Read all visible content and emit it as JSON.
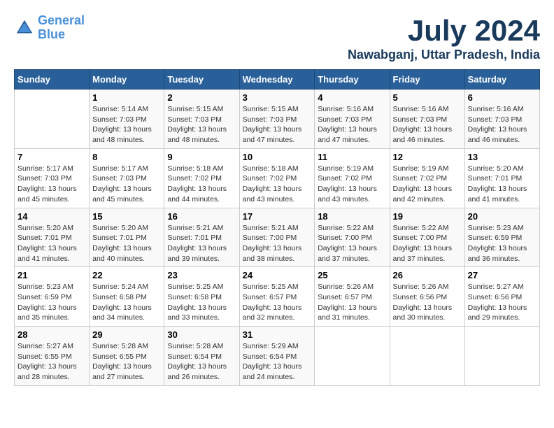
{
  "header": {
    "logo_line1": "General",
    "logo_line2": "Blue",
    "month_year": "July 2024",
    "location": "Nawabganj, Uttar Pradesh, India"
  },
  "weekdays": [
    "Sunday",
    "Monday",
    "Tuesday",
    "Wednesday",
    "Thursday",
    "Friday",
    "Saturday"
  ],
  "weeks": [
    [
      {
        "day": "",
        "info": ""
      },
      {
        "day": "1",
        "info": "Sunrise: 5:14 AM\nSunset: 7:03 PM\nDaylight: 13 hours\nand 48 minutes."
      },
      {
        "day": "2",
        "info": "Sunrise: 5:15 AM\nSunset: 7:03 PM\nDaylight: 13 hours\nand 48 minutes."
      },
      {
        "day": "3",
        "info": "Sunrise: 5:15 AM\nSunset: 7:03 PM\nDaylight: 13 hours\nand 47 minutes."
      },
      {
        "day": "4",
        "info": "Sunrise: 5:16 AM\nSunset: 7:03 PM\nDaylight: 13 hours\nand 47 minutes."
      },
      {
        "day": "5",
        "info": "Sunrise: 5:16 AM\nSunset: 7:03 PM\nDaylight: 13 hours\nand 46 minutes."
      },
      {
        "day": "6",
        "info": "Sunrise: 5:16 AM\nSunset: 7:03 PM\nDaylight: 13 hours\nand 46 minutes."
      }
    ],
    [
      {
        "day": "7",
        "info": "Sunrise: 5:17 AM\nSunset: 7:03 PM\nDaylight: 13 hours\nand 45 minutes."
      },
      {
        "day": "8",
        "info": "Sunrise: 5:17 AM\nSunset: 7:03 PM\nDaylight: 13 hours\nand 45 minutes."
      },
      {
        "day": "9",
        "info": "Sunrise: 5:18 AM\nSunset: 7:02 PM\nDaylight: 13 hours\nand 44 minutes."
      },
      {
        "day": "10",
        "info": "Sunrise: 5:18 AM\nSunset: 7:02 PM\nDaylight: 13 hours\nand 43 minutes."
      },
      {
        "day": "11",
        "info": "Sunrise: 5:19 AM\nSunset: 7:02 PM\nDaylight: 13 hours\nand 43 minutes."
      },
      {
        "day": "12",
        "info": "Sunrise: 5:19 AM\nSunset: 7:02 PM\nDaylight: 13 hours\nand 42 minutes."
      },
      {
        "day": "13",
        "info": "Sunrise: 5:20 AM\nSunset: 7:01 PM\nDaylight: 13 hours\nand 41 minutes."
      }
    ],
    [
      {
        "day": "14",
        "info": "Sunrise: 5:20 AM\nSunset: 7:01 PM\nDaylight: 13 hours\nand 41 minutes."
      },
      {
        "day": "15",
        "info": "Sunrise: 5:20 AM\nSunset: 7:01 PM\nDaylight: 13 hours\nand 40 minutes."
      },
      {
        "day": "16",
        "info": "Sunrise: 5:21 AM\nSunset: 7:01 PM\nDaylight: 13 hours\nand 39 minutes."
      },
      {
        "day": "17",
        "info": "Sunrise: 5:21 AM\nSunset: 7:00 PM\nDaylight: 13 hours\nand 38 minutes."
      },
      {
        "day": "18",
        "info": "Sunrise: 5:22 AM\nSunset: 7:00 PM\nDaylight: 13 hours\nand 37 minutes."
      },
      {
        "day": "19",
        "info": "Sunrise: 5:22 AM\nSunset: 7:00 PM\nDaylight: 13 hours\nand 37 minutes."
      },
      {
        "day": "20",
        "info": "Sunrise: 5:23 AM\nSunset: 6:59 PM\nDaylight: 13 hours\nand 36 minutes."
      }
    ],
    [
      {
        "day": "21",
        "info": "Sunrise: 5:23 AM\nSunset: 6:59 PM\nDaylight: 13 hours\nand 35 minutes."
      },
      {
        "day": "22",
        "info": "Sunrise: 5:24 AM\nSunset: 6:58 PM\nDaylight: 13 hours\nand 34 minutes."
      },
      {
        "day": "23",
        "info": "Sunrise: 5:25 AM\nSunset: 6:58 PM\nDaylight: 13 hours\nand 33 minutes."
      },
      {
        "day": "24",
        "info": "Sunrise: 5:25 AM\nSunset: 6:57 PM\nDaylight: 13 hours\nand 32 minutes."
      },
      {
        "day": "25",
        "info": "Sunrise: 5:26 AM\nSunset: 6:57 PM\nDaylight: 13 hours\nand 31 minutes."
      },
      {
        "day": "26",
        "info": "Sunrise: 5:26 AM\nSunset: 6:56 PM\nDaylight: 13 hours\nand 30 minutes."
      },
      {
        "day": "27",
        "info": "Sunrise: 5:27 AM\nSunset: 6:56 PM\nDaylight: 13 hours\nand 29 minutes."
      }
    ],
    [
      {
        "day": "28",
        "info": "Sunrise: 5:27 AM\nSunset: 6:55 PM\nDaylight: 13 hours\nand 28 minutes."
      },
      {
        "day": "29",
        "info": "Sunrise: 5:28 AM\nSunset: 6:55 PM\nDaylight: 13 hours\nand 27 minutes."
      },
      {
        "day": "30",
        "info": "Sunrise: 5:28 AM\nSunset: 6:54 PM\nDaylight: 13 hours\nand 26 minutes."
      },
      {
        "day": "31",
        "info": "Sunrise: 5:29 AM\nSunset: 6:54 PM\nDaylight: 13 hours\nand 24 minutes."
      },
      {
        "day": "",
        "info": ""
      },
      {
        "day": "",
        "info": ""
      },
      {
        "day": "",
        "info": ""
      }
    ]
  ]
}
